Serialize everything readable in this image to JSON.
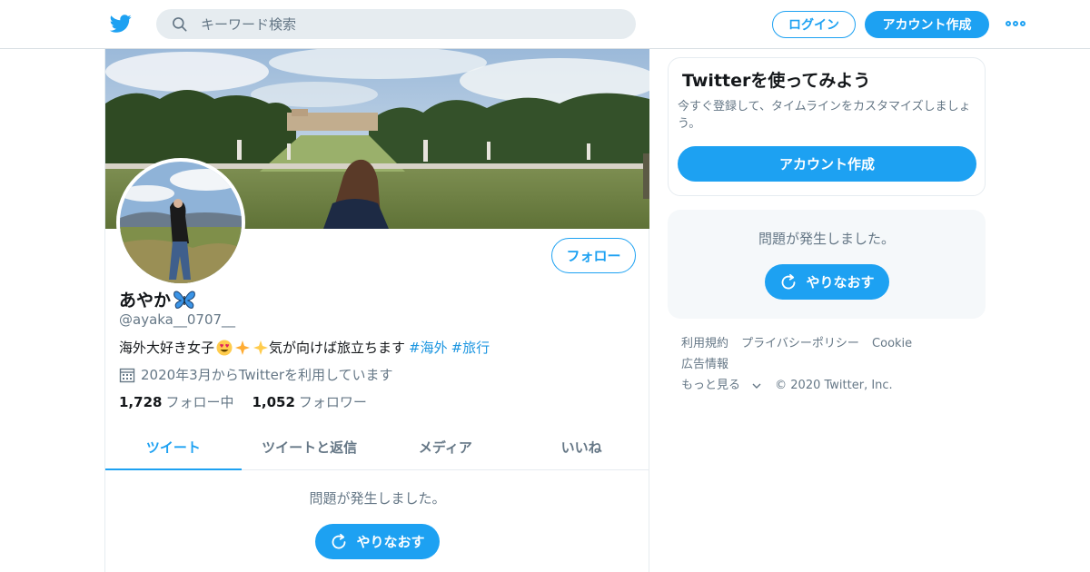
{
  "header": {
    "search_placeholder": "キーワード検索",
    "login_label": "ログイン",
    "signup_label": "アカウント作成"
  },
  "profile": {
    "display_name": "あやか",
    "handle": "@ayaka__0707__",
    "bio_text": "海外大好き女子",
    "bio_text2": " 気が向けば旅立ちます",
    "hashtags": [
      "#海外",
      "#旅行"
    ],
    "joined": "2020年3月からTwitterを利用しています",
    "following_count": "1,728",
    "following_label": "フォロー中",
    "followers_count": "1,052",
    "followers_label": "フォロワー",
    "follow_button": "フォロー"
  },
  "tabs": [
    {
      "label": "ツイート",
      "active": true
    },
    {
      "label": "ツイートと返信",
      "active": false
    },
    {
      "label": "メディア",
      "active": false
    },
    {
      "label": "いいね",
      "active": false
    }
  ],
  "timeline": {
    "error_message": "問題が発生しました。",
    "retry_label": "やりなおす"
  },
  "sidebar": {
    "signup_card": {
      "title": "Twitterを使ってみよう",
      "description": "今すぐ登録して、タイムラインをカスタマイズしましょう。",
      "button": "アカウント作成"
    },
    "error_card": {
      "message": "問題が発生しました。",
      "retry_label": "やりなおす"
    },
    "footer_links": [
      "利用規約",
      "プライバシーポリシー",
      "Cookie",
      "広告情報",
      "もっと見る"
    ],
    "copyright": "© 2020 Twitter, Inc."
  },
  "colors": {
    "accent": "#1da1f2",
    "muted_text": "#657786",
    "hashtag": "#1b95e0"
  },
  "icons": [
    "twitter-bird-icon",
    "search-icon",
    "more-icon",
    "calendar-icon",
    "refresh-icon",
    "chevron-down-icon",
    "butterfly-emoji",
    "heart-eyes-emoji",
    "sparkles-emoji"
  ]
}
